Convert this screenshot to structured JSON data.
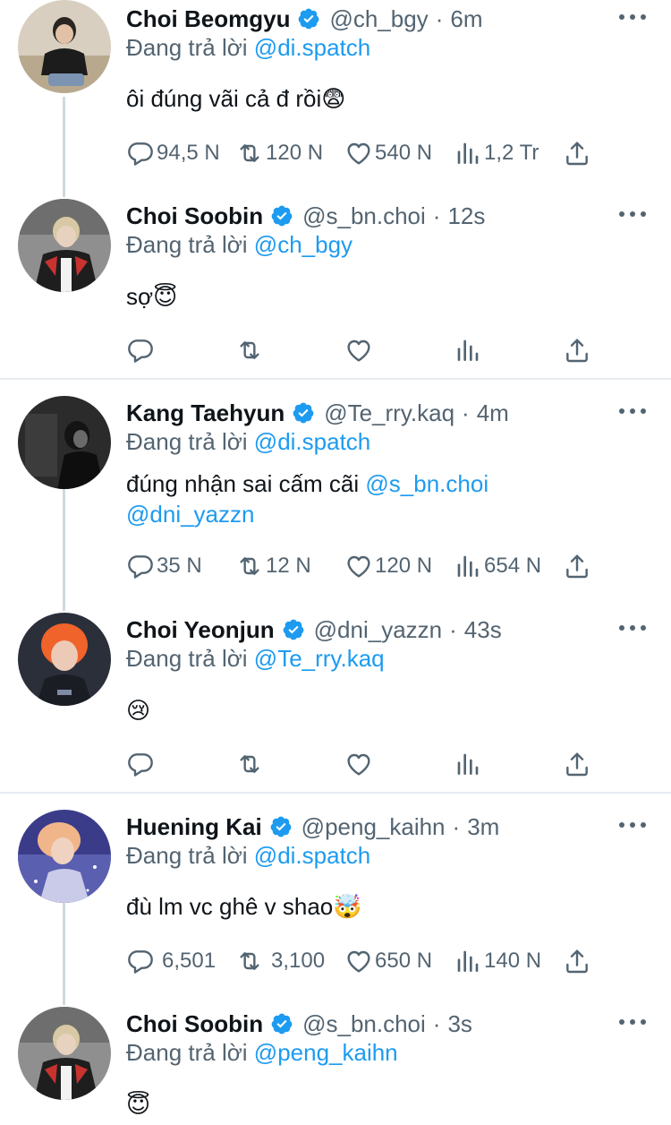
{
  "reply_prefix": "Đang trả lời",
  "colors": {
    "accent": "#1d9bf0",
    "muted": "#536471",
    "text": "#0f1419"
  },
  "tweets": [
    {
      "name": "Choi Beomgyu",
      "handle": "@ch_bgy",
      "time": "6m",
      "reply_to": "@di.spatch",
      "text": "ôi đúng vãi cả đ rồi",
      "emoji": "😨",
      "replies": "94,5 N",
      "retweets": "120 N",
      "likes": "540 N",
      "views": "1,2 Tr"
    },
    {
      "name": "Choi Soobin",
      "handle": "@s_bn.choi",
      "time": "12s",
      "reply_to": "@ch_bgy",
      "text": "sợ",
      "emoji": "😇"
    },
    {
      "name": "Kang Taehyun",
      "handle": "@Te_rry.kaq",
      "time": "4m",
      "reply_to": "@di.spatch",
      "text": "đúng nhận sai cấm cãi",
      "mention1": "@s_bn.choi",
      "mention2": "@dni_yazzn",
      "replies": "35 N",
      "retweets": "12 N",
      "likes": "120 N",
      "views": "654 N"
    },
    {
      "name": "Choi Yeonjun",
      "handle": "@dni_yazzn",
      "time": "43s",
      "reply_to": "@Te_rry.kaq",
      "emoji": "😢"
    },
    {
      "name": "Huening Kai",
      "handle": "@peng_kaihn",
      "time": "3m",
      "reply_to": "@di.spatch",
      "text": "đù lm vc ghê v shao",
      "emoji": "🤯",
      "replies": "6,501",
      "retweets": "3,100",
      "likes": "650 N",
      "views": "140 N"
    },
    {
      "name": "Choi Soobin",
      "handle": "@s_bn.choi",
      "time": "3s",
      "reply_to": "@peng_kaihn",
      "emoji": "😇"
    }
  ]
}
